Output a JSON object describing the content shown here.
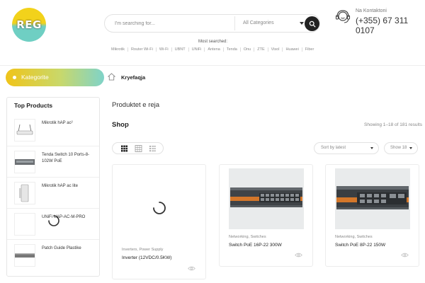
{
  "header": {
    "logo_text": "REG",
    "search": {
      "placeholder": "I'm searching for...",
      "category": "All Categories"
    },
    "most_searched": {
      "title": "Most searched:",
      "tags": [
        "Mikrotik",
        "Router Wi-Fi",
        "Wi-Fi",
        "UBNT",
        "UNiFi",
        "Antena",
        "Tenda",
        "Onu",
        "ZTE",
        "Visol",
        "Huawei",
        "Fiber"
      ]
    },
    "contact": {
      "label": "Na Kontaktoni",
      "phone": "(+355) 67 311 0107"
    }
  },
  "nav": {
    "categories_button": "Kategorite",
    "breadcrumb": "Kryefaqja"
  },
  "sidebar": {
    "title": "Top Products",
    "items": [
      {
        "name": "Mikrotik hAP ac²",
        "icon": "router-thumb"
      },
      {
        "name": "Tenda Switch 10 Ports-8-102W PoE",
        "icon": "switch-thumb"
      },
      {
        "name": "Mikrotik hAP ac lite",
        "icon": "router-vertical-thumb"
      },
      {
        "name": "UNiFi UAP-AC-M-PRO",
        "icon": "loading-spinner"
      },
      {
        "name": "Patch Guide Plastike",
        "icon": "patch-panel-thumb"
      }
    ]
  },
  "main": {
    "section_title": "Produktet e reja",
    "shop_title": "Shop",
    "results_text": "Showing 1–18 of 181 results",
    "sort": "Sort by latest",
    "show": "Show 18",
    "products": [
      {
        "category": "Inverters, Power Supply",
        "name": "Inverter (12VDC/0.5KW)",
        "image": "loading-spinner"
      },
      {
        "category": "Networking, Switches",
        "name": "Switch PoE 16P-22 300W",
        "image": "switch-16-port"
      },
      {
        "category": "Networking, Switches",
        "name": "Switch PoE 8P-22 150W",
        "image": "switch-8-port"
      }
    ]
  },
  "colors": {
    "accent_yellow": "#f0c419",
    "accent_teal": "#7fd3c9",
    "dark": "#222222"
  }
}
